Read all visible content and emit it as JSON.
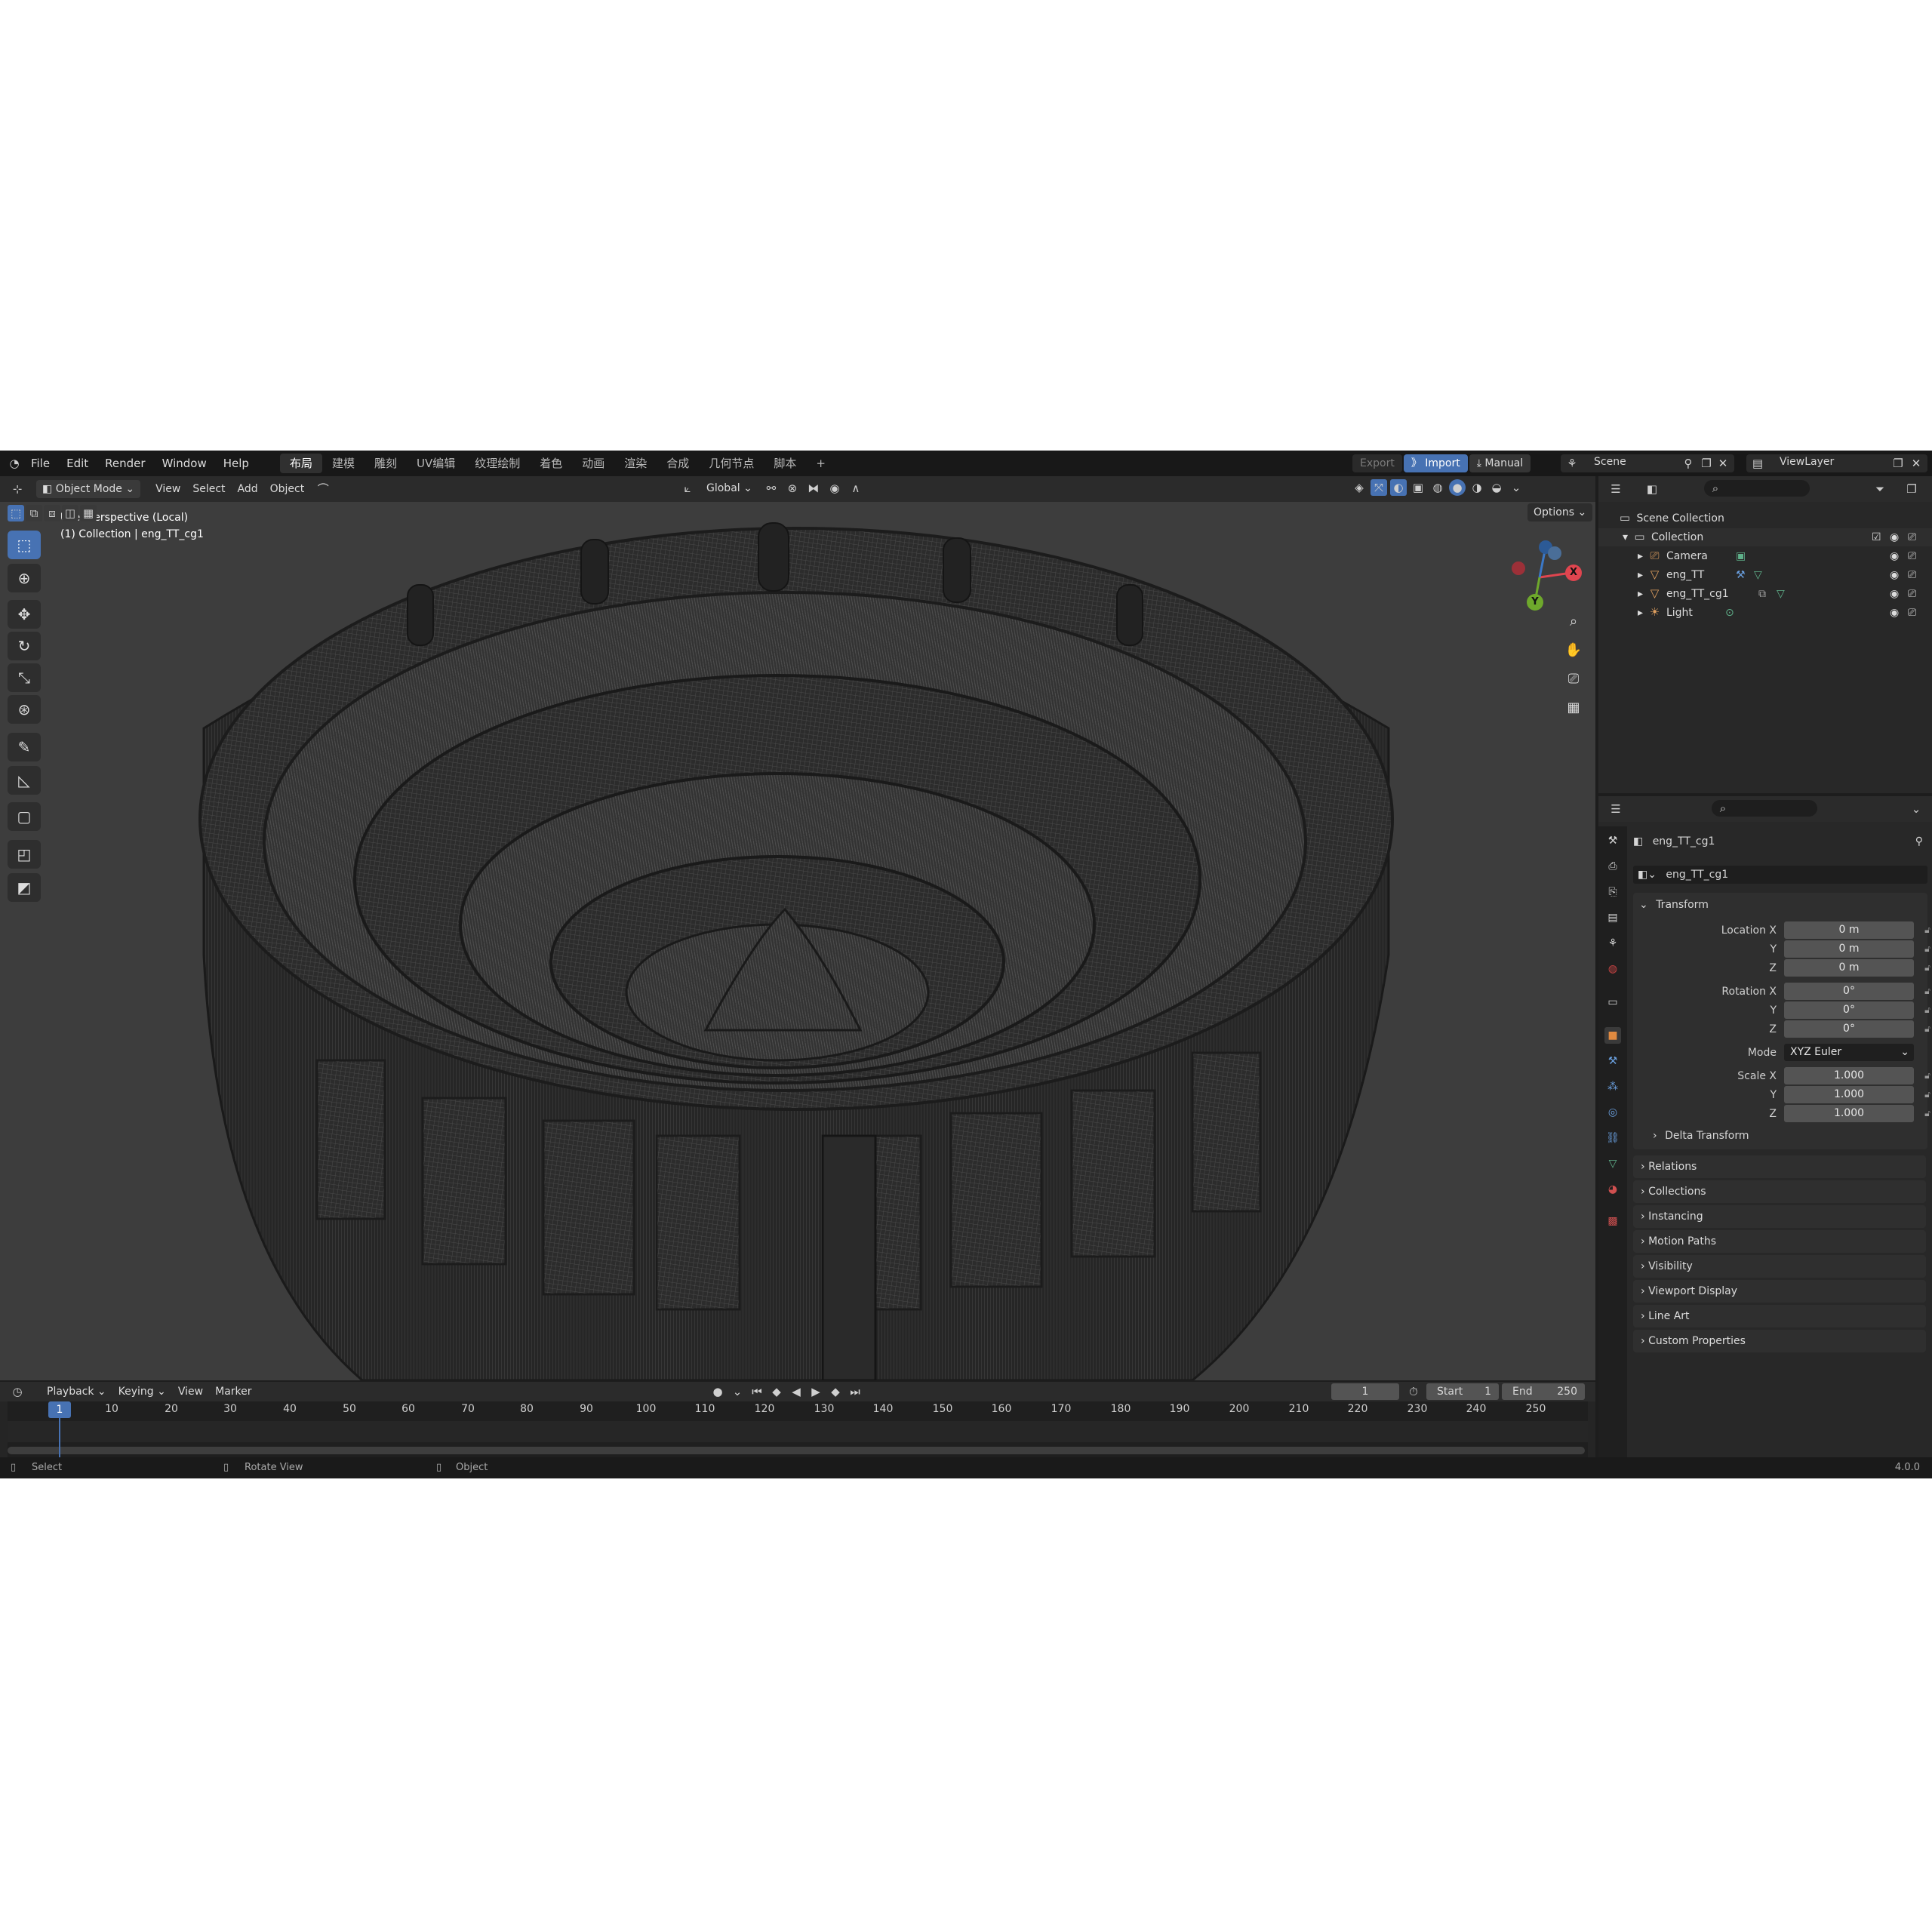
{
  "menubar": {
    "menus": [
      "File",
      "Edit",
      "Render",
      "Window",
      "Help"
    ],
    "workspaces": [
      "布局",
      "建模",
      "雕刻",
      "UV编辑",
      "纹理绘制",
      "着色",
      "动画",
      "渲染",
      "合成",
      "几何节点",
      "脚本"
    ],
    "add_tab": "+",
    "export_label": "Export",
    "import_label": "Import",
    "manual_label": "Manual",
    "scene_label": "Scene",
    "view_layer_label": "ViewLayer"
  },
  "viewport_header": {
    "mode": "Object Mode",
    "menus": [
      "View",
      "Select",
      "Add",
      "Object"
    ],
    "orientation": "Global",
    "options_label": "Options"
  },
  "viewport": {
    "perspective_label": "User Perspective (Local)",
    "collection_label": "(1) Collection | eng_TT_cg1",
    "gizmo": {
      "x": "X",
      "y": "Y",
      "z": "Z"
    }
  },
  "outliner": {
    "scene_collection": "Scene Collection",
    "collection": "Collection",
    "items": [
      {
        "label": "Camera",
        "icon": "camera-icon",
        "color": "#e0a060"
      },
      {
        "label": "eng_TT",
        "icon": "mesh-icon",
        "color": "#e0a060"
      },
      {
        "label": "eng_TT_cg1",
        "icon": "mesh-icon",
        "color": "#e0a060"
      },
      {
        "label": "Light",
        "icon": "light-icon",
        "color": "#e0a060"
      }
    ]
  },
  "properties": {
    "object_name": "eng_TT_cg1",
    "datablock_name": "eng_TT_cg1",
    "transform_title": "Transform",
    "location": {
      "label": "Location X",
      "x": "0 m",
      "y": "0 m",
      "z": "0 m"
    },
    "rotation": {
      "label": "Rotation X",
      "x": "0°",
      "y": "0°",
      "z": "0°"
    },
    "mode": {
      "label": "Mode",
      "value": "XYZ Euler"
    },
    "scale": {
      "label": "Scale X",
      "x": "1.000",
      "y": "1.000",
      "z": "1.000"
    },
    "axis_y": "Y",
    "axis_z": "Z",
    "delta_transform": "Delta Transform",
    "panels": [
      "Relations",
      "Collections",
      "Instancing",
      "Motion Paths",
      "Visibility",
      "Viewport Display",
      "Line Art",
      "Custom Properties"
    ]
  },
  "timeline": {
    "menus": [
      "Playback",
      "Keying",
      "View",
      "Marker"
    ],
    "current_frame": "1",
    "start_label": "Start",
    "start_value": "1",
    "end_label": "End",
    "end_value": "250",
    "frames": [
      "1",
      "10",
      "20",
      "30",
      "40",
      "50",
      "60",
      "70",
      "80",
      "90",
      "100",
      "110",
      "120",
      "130",
      "140",
      "150",
      "160",
      "170",
      "180",
      "190",
      "200",
      "210",
      "220",
      "230",
      "240",
      "250"
    ]
  },
  "status": {
    "select": "Select",
    "rotate": "Rotate View",
    "object": "Object",
    "version": "4.0.0"
  },
  "colors": {
    "accent": "#4772b3",
    "axis_x": "#e0454f",
    "axis_y": "#6ea82c",
    "axis_z": "#3b78c7"
  }
}
